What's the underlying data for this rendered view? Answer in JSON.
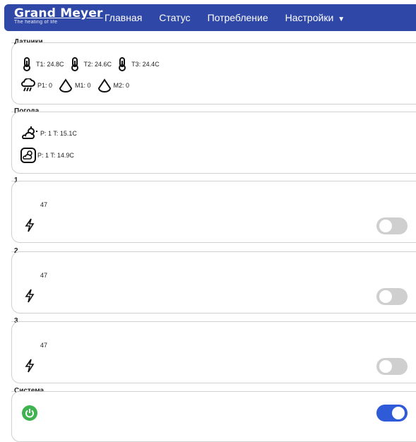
{
  "brand": {
    "title": "Grand Meyer",
    "tagline": "The heating of life"
  },
  "nav": {
    "home": "Главная",
    "status": "Статус",
    "consumption": "Потребление",
    "settings": "Настройки"
  },
  "sensors": {
    "title": "Датчики",
    "t1": "T1: 24.8C",
    "t2": "T2: 24.6C",
    "t3": "T3: 24.4C",
    "p1": "P1: 0",
    "m1": "M1: 0",
    "m2": "M2: 0"
  },
  "weather": {
    "title": "Погода",
    "row1": "P: 1 T: 15.1C",
    "row2": "P: 1 T: 14.9C"
  },
  "channels": [
    {
      "title": "1",
      "value": "47",
      "enabled": false
    },
    {
      "title": "2",
      "value": "47",
      "enabled": false
    },
    {
      "title": "3",
      "value": "47",
      "enabled": false
    }
  ],
  "system": {
    "title": "Система",
    "enabled": true
  },
  "colors": {
    "navbar": "#2f47a6",
    "toggle_on": "#2f5ad8",
    "toggle_off": "#cfcfcf",
    "power": "#3fb34f"
  }
}
